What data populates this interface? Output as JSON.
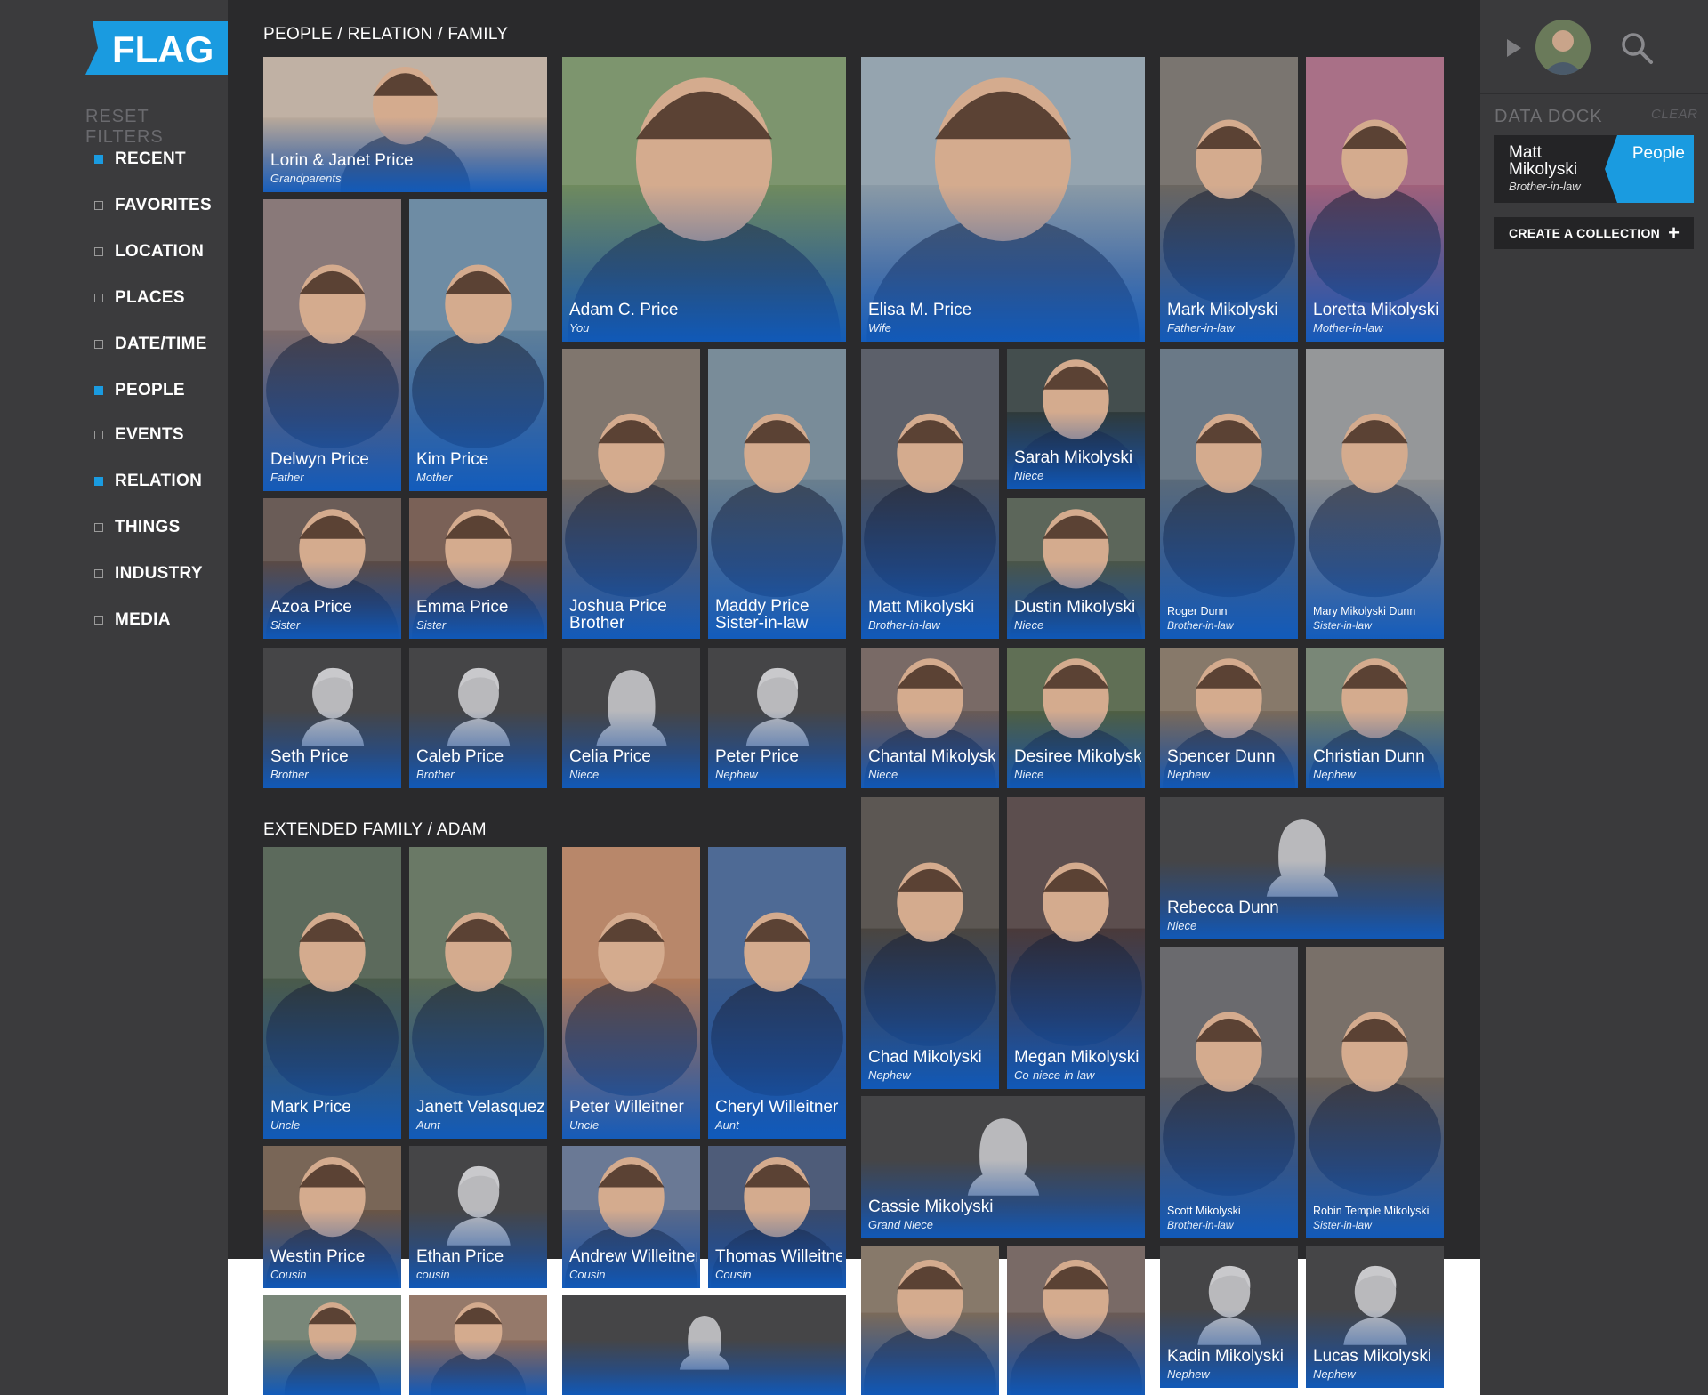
{
  "app": {
    "logo_text": "FLAG",
    "brand_color": "#1a9be0",
    "accent_blue": "#1464c8"
  },
  "sidebar": {
    "reset_label": "RESET FILTERS",
    "filters": [
      {
        "label": "RECENT",
        "checked": true
      },
      {
        "label": "FAVORITES",
        "checked": false
      },
      {
        "label": "LOCATION",
        "checked": false
      },
      {
        "label": "PLACES",
        "checked": false
      },
      {
        "label": "DATE/TIME",
        "checked": false
      },
      {
        "label": "PEOPLE",
        "checked": true
      },
      {
        "label": "EVENTS",
        "checked": false
      },
      {
        "label": "RELATION",
        "checked": true
      },
      {
        "label": "THINGS",
        "checked": false
      },
      {
        "label": "INDUSTRY",
        "checked": false
      },
      {
        "label": "MEDIA",
        "checked": false
      }
    ]
  },
  "sections": {
    "family_title": "PEOPLE / RELATION / FAMILY",
    "extended_title": "EXTENDED FAMILY / ADAM"
  },
  "people": [
    {
      "name": "Lorin & Janet Price",
      "relation": "Grandparents",
      "photo": true,
      "tone": "#b9a99a"
    },
    {
      "name": "Delwyn Price",
      "relation": "Father",
      "photo": true,
      "tone": "#7c6a6a"
    },
    {
      "name": "Kim Price",
      "relation": "Mother",
      "photo": true,
      "tone": "#5e7f9a"
    },
    {
      "name": "Azoa Price",
      "relation": "Sister",
      "photo": true,
      "tone": "#5a4a45"
    },
    {
      "name": "Emma Price",
      "relation": "Sister",
      "photo": true,
      "tone": "#6b5045"
    },
    {
      "name": "Seth Price",
      "relation": "Brother",
      "photo": false
    },
    {
      "name": "Caleb Price",
      "relation": "Brother",
      "photo": false
    },
    {
      "name": "Adam C. Price",
      "relation": "You",
      "photo": true,
      "tone": "#6f8a5e"
    },
    {
      "name": "Joshua Price\nBrother",
      "relation": "",
      "photo": true,
      "tone": "#72675e"
    },
    {
      "name": "Maddy Price\nSister-in-law",
      "relation": "",
      "photo": true,
      "tone": "#6a7f8e"
    },
    {
      "name": "Celia Price",
      "relation": "Niece",
      "photo": false,
      "female": true
    },
    {
      "name": "Peter Price",
      "relation": "Nephew",
      "photo": false
    },
    {
      "name": "Elisa M. Price",
      "relation": "Wife",
      "photo": true,
      "tone": "#8a9aa6"
    },
    {
      "name": "Matt Mikolyski",
      "relation": "Brother-in-law",
      "photo": true,
      "tone": "#4a4f5a"
    },
    {
      "name": "Sarah Mikolyski",
      "relation": "Niece",
      "photo": true,
      "tone": "#2f3a3a"
    },
    {
      "name": "Dustin Mikolyski",
      "relation": "Niece",
      "photo": true,
      "tone": "#4a5548"
    },
    {
      "name": "Chantal Mikolyski",
      "relation": "Niece",
      "photo": true,
      "tone": "#6a5a55"
    },
    {
      "name": "Desiree Mikolyski",
      "relation": "Niece",
      "photo": true,
      "tone": "#4f5f42"
    },
    {
      "name": "Mark Mikolyski",
      "relation": "Father-in-law",
      "photo": true,
      "tone": "#6b6660"
    },
    {
      "name": "Loretta Mikolyski",
      "relation": "Mother-in-law",
      "photo": true,
      "tone": "#a0607a"
    },
    {
      "name": "Roger Dunn",
      "relation": "Brother-in-law",
      "photo": true,
      "tone": "#5a6a7a",
      "small": true
    },
    {
      "name": "Mary Mikolyski Dunn",
      "relation": "Sister-in-law",
      "photo": true,
      "tone": "#8a8c8e",
      "small": true
    },
    {
      "name": "Spencer Dunn",
      "relation": "Nephew",
      "photo": true,
      "tone": "#7a6a5a"
    },
    {
      "name": "Christian Dunn",
      "relation": "Nephew",
      "photo": true,
      "tone": "#6a7a68"
    },
    {
      "name": "Mark Price",
      "relation": "Uncle",
      "photo": true,
      "tone": "#4a5a4a"
    },
    {
      "name": "Janett Velasquez",
      "relation": "Aunt",
      "photo": true,
      "tone": "#5a6a55"
    },
    {
      "name": "Peter Willeitner",
      "relation": "Uncle",
      "photo": true,
      "tone": "#b07a5a"
    },
    {
      "name": "Cheryl Willeitner",
      "relation": "Aunt",
      "photo": true,
      "tone": "#3a5a8a"
    },
    {
      "name": "Westin Price",
      "relation": "Cousin",
      "photo": true,
      "tone": "#6a5545"
    },
    {
      "name": "Ethan Price",
      "relation": "cousin",
      "photo": false
    },
    {
      "name": "Andrew Willeitner",
      "relation": "Cousin",
      "photo": true,
      "tone": "#5a6a8a"
    },
    {
      "name": "Thomas Willeitner",
      "relation": "Cousin",
      "photo": true,
      "tone": "#3a4a6a"
    },
    {
      "name": "Chad Mikolyski",
      "relation": "Nephew",
      "photo": true,
      "tone": "#4a4540"
    },
    {
      "name": "Megan Mikolyski",
      "relation": "Co-niece-in-law",
      "photo": true,
      "tone": "#4a3a3a"
    },
    {
      "name": "Rebecca Dunn",
      "relation": "Niece",
      "photo": false,
      "female": true
    },
    {
      "name": "Cassie Mikolyski",
      "relation": "Grand Niece",
      "photo": false,
      "female": true
    },
    {
      "name": "Scott Mikolyski",
      "relation": "Brother-in-law",
      "photo": true,
      "tone": "#5a5a5e",
      "small": true
    },
    {
      "name": "Robin Temple Mikolyski",
      "relation": "Sister-in-law",
      "photo": true,
      "tone": "#6a6058",
      "small": true
    },
    {
      "name": "Kadin Mikolyski",
      "relation": "Nephew",
      "photo": false
    },
    {
      "name": "Lucas Mikolyski",
      "relation": "Nephew",
      "photo": false
    },
    {
      "name": "",
      "relation": "",
      "photo": true,
      "tone": "#6a7a6a"
    },
    {
      "name": "",
      "relation": "",
      "photo": true,
      "tone": "#8a6a5a"
    },
    {
      "name": "",
      "relation": "",
      "photo": false,
      "female": true
    },
    {
      "name": "",
      "relation": "",
      "photo": true,
      "tone": "#7a6a5a"
    },
    {
      "name": "",
      "relation": "",
      "photo": true,
      "tone": "#6a5a55"
    }
  ],
  "dock": {
    "title": "DATA DOCK",
    "clear_label": "CLEAR",
    "card_name": "Matt Mikolyski",
    "card_relation": "Brother-in-law",
    "card_tag": "People",
    "create_label": "CREATE A COLLECTION",
    "create_icon": "+"
  }
}
